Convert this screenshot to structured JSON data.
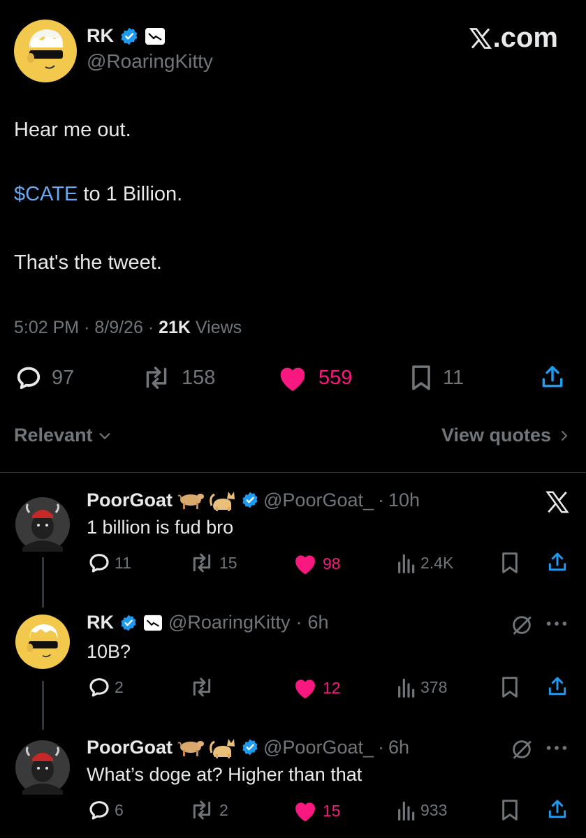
{
  "main_tweet": {
    "author_name": "RK",
    "author_handle": "@RoaringKitty",
    "site_label": "X.com",
    "lines": {
      "line1": "Hear me out.",
      "cashtag": "$CATE",
      "line2_rest": " to 1 Billion.",
      "line3": "That's the tweet."
    },
    "time": "5:02 PM",
    "date": "8/9/26",
    "views_count": "21K",
    "views_label": "Views",
    "replies": "97",
    "reposts": "158",
    "likes": "559",
    "bookmarks": "11"
  },
  "filters": {
    "sort_label": "Relevant",
    "view_quotes_label": "View quotes"
  },
  "replies": [
    {
      "name": "PoorGoat",
      "handle": "@PoorGoat_",
      "time": "10h",
      "text": "1 billion is fud bro",
      "replies": "11",
      "reposts": "15",
      "likes": "98",
      "views": "2.4K"
    },
    {
      "name": "RK",
      "handle": "@RoaringKitty",
      "time": "6h",
      "text": "10B?",
      "replies": "2",
      "reposts": "",
      "likes": "12",
      "views": "378"
    },
    {
      "name": "PoorGoat",
      "handle": "@PoorGoat_",
      "time": "6h",
      "text": "What’s doge at? Higher than that",
      "replies": "6",
      "reposts": "2",
      "likes": "15",
      "views": "933"
    }
  ],
  "colors": {
    "background": "#000000",
    "like_pink": "#f91880",
    "verified_blue": "#1d9bf0",
    "gray_text": "#71767b"
  }
}
